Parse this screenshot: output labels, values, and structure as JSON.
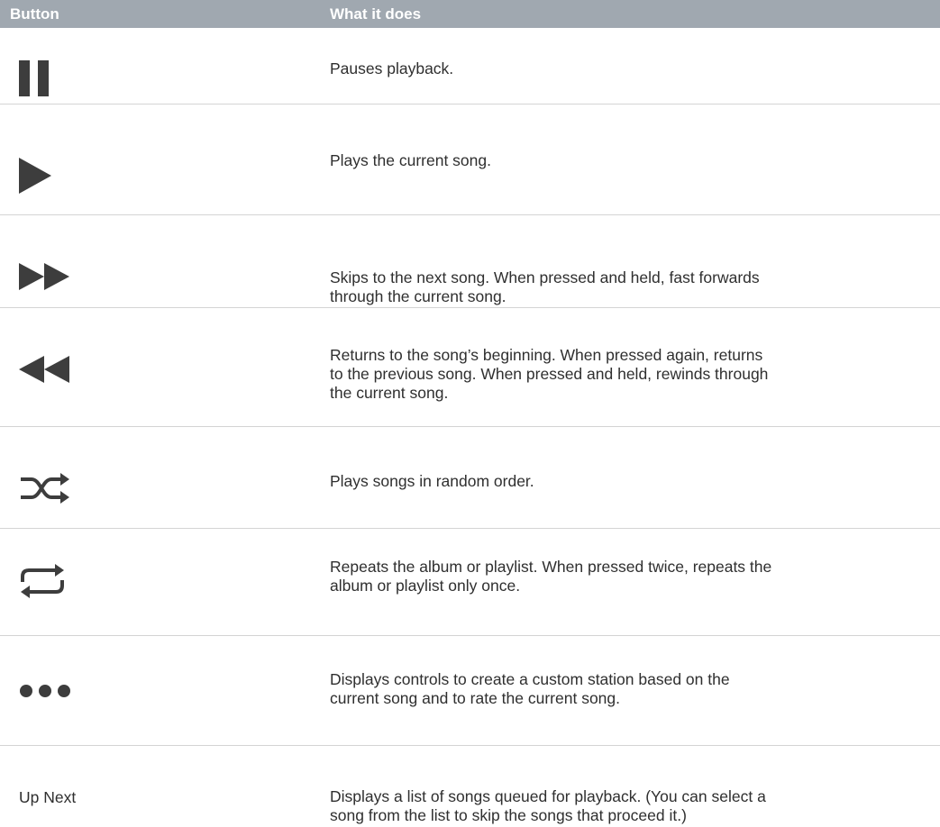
{
  "header": {
    "col_button": "Button",
    "col_what": "What it does"
  },
  "colors": {
    "header_bg": "#a0a8b0",
    "header_text": "#ffffff",
    "icon": "#3d3d3d",
    "divider": "#d4d4d4"
  },
  "rows": [
    {
      "icon": "pause-icon",
      "description": "Pauses playback."
    },
    {
      "icon": "play-icon",
      "description": "Plays the current song."
    },
    {
      "icon": "fast-forward-icon",
      "description": "Skips to the next song. When pressed and held, fast forwards\nthrough the current song."
    },
    {
      "icon": "rewind-icon",
      "description": "Returns to the song’s beginning. When pressed again, returns\nto the previous song. When pressed and held, rewinds through\nthe current song."
    },
    {
      "icon": "shuffle-icon",
      "description": "Plays songs in random order."
    },
    {
      "icon": "repeat-icon",
      "description": "Repeats the album or playlist. When pressed twice, repeats the\nalbum or playlist only once."
    },
    {
      "icon": "more-icon",
      "description": "Displays controls to create a custom station based on the\ncurrent song and to rate the current song."
    },
    {
      "label": "Up Next",
      "description": "Displays a list of songs queued for playback. (You can select a\nsong from the list to skip the songs that proceed it.)"
    }
  ]
}
